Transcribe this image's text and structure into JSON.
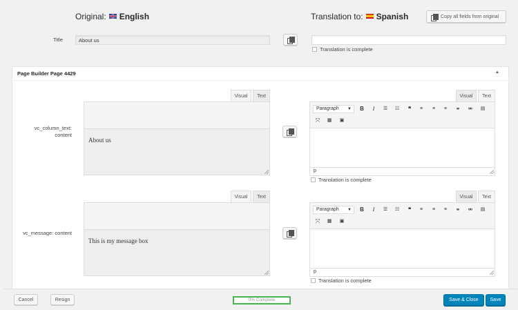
{
  "header": {
    "original_label": "Original:",
    "original_lang": "English",
    "translation_label": "Translation to:",
    "translation_lang": "Spanish",
    "copy_all_label": "Copy all fields from original"
  },
  "title_field": {
    "label": "Title",
    "original_value": "About us",
    "translation_value": "",
    "complete_label": "Translation is complete"
  },
  "section": {
    "title": "Page Builder Page 4429",
    "toggle_glyph": "▲"
  },
  "fields": [
    {
      "label_line1": "vc_column_text:",
      "label_line2": "content",
      "original_content": "About us",
      "tab_visual": "Visual",
      "tab_text": "Text",
      "paragraph_select": "Paragraph",
      "path": "p",
      "complete_label": "Translation is complete"
    },
    {
      "label_line1": "vc_message: content",
      "label_line2": "",
      "original_content": "This is my message box",
      "tab_visual": "Visual",
      "tab_text": "Text",
      "paragraph_select": "Paragraph",
      "path": "p",
      "complete_label": "Translation is complete"
    }
  ],
  "toolbar_icons": [
    "bold-icon",
    "italic-icon",
    "bullet-list-icon",
    "numbered-list-icon",
    "blockquote-icon",
    "align-left-icon",
    "align-center-icon",
    "align-right-icon",
    "link-icon",
    "unlink-icon",
    "read-more-icon",
    "fullscreen-icon",
    "toolbar-toggle-icon",
    "add-media-icon"
  ],
  "footer": {
    "cancel_label": "Cancel",
    "resign_label": "Resign",
    "progress_label": "0% Complete",
    "progress_value": 0,
    "save_close_label": "Save & Close",
    "save_label": "Save"
  },
  "colors": {
    "primary": "#0085ba",
    "progress_border": "#46b450"
  }
}
